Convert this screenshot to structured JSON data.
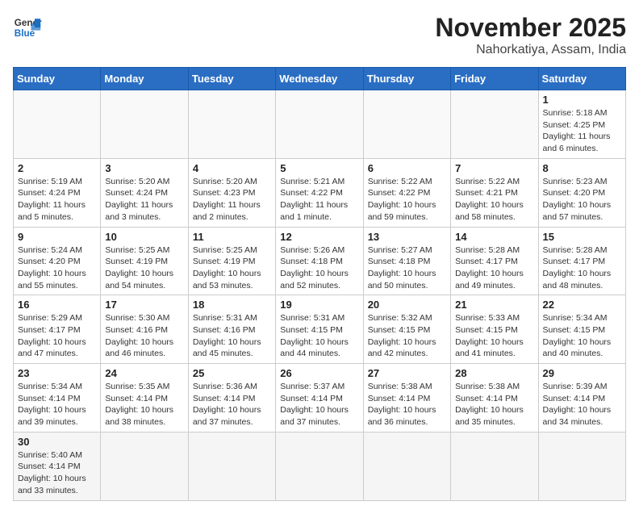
{
  "header": {
    "logo_general": "General",
    "logo_blue": "Blue",
    "month_title": "November 2025",
    "location": "Nahorkatiya, Assam, India"
  },
  "days_of_week": [
    "Sunday",
    "Monday",
    "Tuesday",
    "Wednesday",
    "Thursday",
    "Friday",
    "Saturday"
  ],
  "weeks": [
    [
      {
        "day": "",
        "info": ""
      },
      {
        "day": "",
        "info": ""
      },
      {
        "day": "",
        "info": ""
      },
      {
        "day": "",
        "info": ""
      },
      {
        "day": "",
        "info": ""
      },
      {
        "day": "",
        "info": ""
      },
      {
        "day": "1",
        "info": "Sunrise: 5:18 AM\nSunset: 4:25 PM\nDaylight: 11 hours\nand 6 minutes."
      }
    ],
    [
      {
        "day": "2",
        "info": "Sunrise: 5:19 AM\nSunset: 4:24 PM\nDaylight: 11 hours\nand 5 minutes."
      },
      {
        "day": "3",
        "info": "Sunrise: 5:20 AM\nSunset: 4:24 PM\nDaylight: 11 hours\nand 3 minutes."
      },
      {
        "day": "4",
        "info": "Sunrise: 5:20 AM\nSunset: 4:23 PM\nDaylight: 11 hours\nand 2 minutes."
      },
      {
        "day": "5",
        "info": "Sunrise: 5:21 AM\nSunset: 4:22 PM\nDaylight: 11 hours\nand 1 minute."
      },
      {
        "day": "6",
        "info": "Sunrise: 5:22 AM\nSunset: 4:22 PM\nDaylight: 10 hours\nand 59 minutes."
      },
      {
        "day": "7",
        "info": "Sunrise: 5:22 AM\nSunset: 4:21 PM\nDaylight: 10 hours\nand 58 minutes."
      },
      {
        "day": "8",
        "info": "Sunrise: 5:23 AM\nSunset: 4:20 PM\nDaylight: 10 hours\nand 57 minutes."
      }
    ],
    [
      {
        "day": "9",
        "info": "Sunrise: 5:24 AM\nSunset: 4:20 PM\nDaylight: 10 hours\nand 55 minutes."
      },
      {
        "day": "10",
        "info": "Sunrise: 5:25 AM\nSunset: 4:19 PM\nDaylight: 10 hours\nand 54 minutes."
      },
      {
        "day": "11",
        "info": "Sunrise: 5:25 AM\nSunset: 4:19 PM\nDaylight: 10 hours\nand 53 minutes."
      },
      {
        "day": "12",
        "info": "Sunrise: 5:26 AM\nSunset: 4:18 PM\nDaylight: 10 hours\nand 52 minutes."
      },
      {
        "day": "13",
        "info": "Sunrise: 5:27 AM\nSunset: 4:18 PM\nDaylight: 10 hours\nand 50 minutes."
      },
      {
        "day": "14",
        "info": "Sunrise: 5:28 AM\nSunset: 4:17 PM\nDaylight: 10 hours\nand 49 minutes."
      },
      {
        "day": "15",
        "info": "Sunrise: 5:28 AM\nSunset: 4:17 PM\nDaylight: 10 hours\nand 48 minutes."
      }
    ],
    [
      {
        "day": "16",
        "info": "Sunrise: 5:29 AM\nSunset: 4:17 PM\nDaylight: 10 hours\nand 47 minutes."
      },
      {
        "day": "17",
        "info": "Sunrise: 5:30 AM\nSunset: 4:16 PM\nDaylight: 10 hours\nand 46 minutes."
      },
      {
        "day": "18",
        "info": "Sunrise: 5:31 AM\nSunset: 4:16 PM\nDaylight: 10 hours\nand 45 minutes."
      },
      {
        "day": "19",
        "info": "Sunrise: 5:31 AM\nSunset: 4:15 PM\nDaylight: 10 hours\nand 44 minutes."
      },
      {
        "day": "20",
        "info": "Sunrise: 5:32 AM\nSunset: 4:15 PM\nDaylight: 10 hours\nand 42 minutes."
      },
      {
        "day": "21",
        "info": "Sunrise: 5:33 AM\nSunset: 4:15 PM\nDaylight: 10 hours\nand 41 minutes."
      },
      {
        "day": "22",
        "info": "Sunrise: 5:34 AM\nSunset: 4:15 PM\nDaylight: 10 hours\nand 40 minutes."
      }
    ],
    [
      {
        "day": "23",
        "info": "Sunrise: 5:34 AM\nSunset: 4:14 PM\nDaylight: 10 hours\nand 39 minutes."
      },
      {
        "day": "24",
        "info": "Sunrise: 5:35 AM\nSunset: 4:14 PM\nDaylight: 10 hours\nand 38 minutes."
      },
      {
        "day": "25",
        "info": "Sunrise: 5:36 AM\nSunset: 4:14 PM\nDaylight: 10 hours\nand 37 minutes."
      },
      {
        "day": "26",
        "info": "Sunrise: 5:37 AM\nSunset: 4:14 PM\nDaylight: 10 hours\nand 37 minutes."
      },
      {
        "day": "27",
        "info": "Sunrise: 5:38 AM\nSunset: 4:14 PM\nDaylight: 10 hours\nand 36 minutes."
      },
      {
        "day": "28",
        "info": "Sunrise: 5:38 AM\nSunset: 4:14 PM\nDaylight: 10 hours\nand 35 minutes."
      },
      {
        "day": "29",
        "info": "Sunrise: 5:39 AM\nSunset: 4:14 PM\nDaylight: 10 hours\nand 34 minutes."
      }
    ],
    [
      {
        "day": "30",
        "info": "Sunrise: 5:40 AM\nSunset: 4:14 PM\nDaylight: 10 hours\nand 33 minutes."
      },
      {
        "day": "",
        "info": ""
      },
      {
        "day": "",
        "info": ""
      },
      {
        "day": "",
        "info": ""
      },
      {
        "day": "",
        "info": ""
      },
      {
        "day": "",
        "info": ""
      },
      {
        "day": "",
        "info": ""
      }
    ]
  ]
}
